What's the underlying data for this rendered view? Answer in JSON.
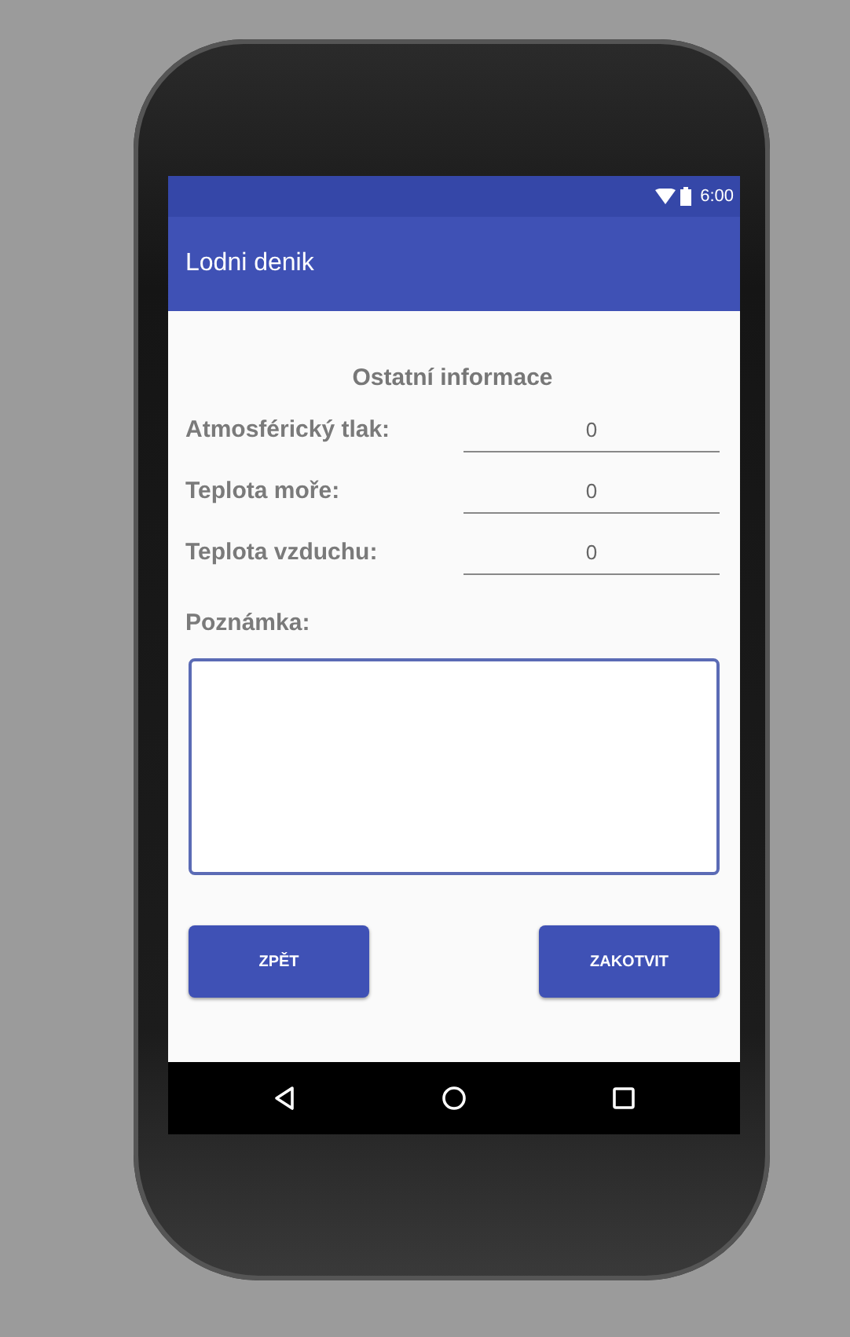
{
  "status_bar": {
    "time": "6:00"
  },
  "app_bar": {
    "title": "Lodni denik"
  },
  "heading": "Ostatní informace",
  "fields": [
    {
      "label": "Atmosférický tlak:",
      "value": "0"
    },
    {
      "label": "Teplota moře:",
      "value": "0"
    },
    {
      "label": "Teplota vzduchu:",
      "value": "0"
    }
  ],
  "note": {
    "label": "Poznámka:"
  },
  "buttons": [
    "ZPĚT",
    "ZAKOTVIT"
  ]
}
